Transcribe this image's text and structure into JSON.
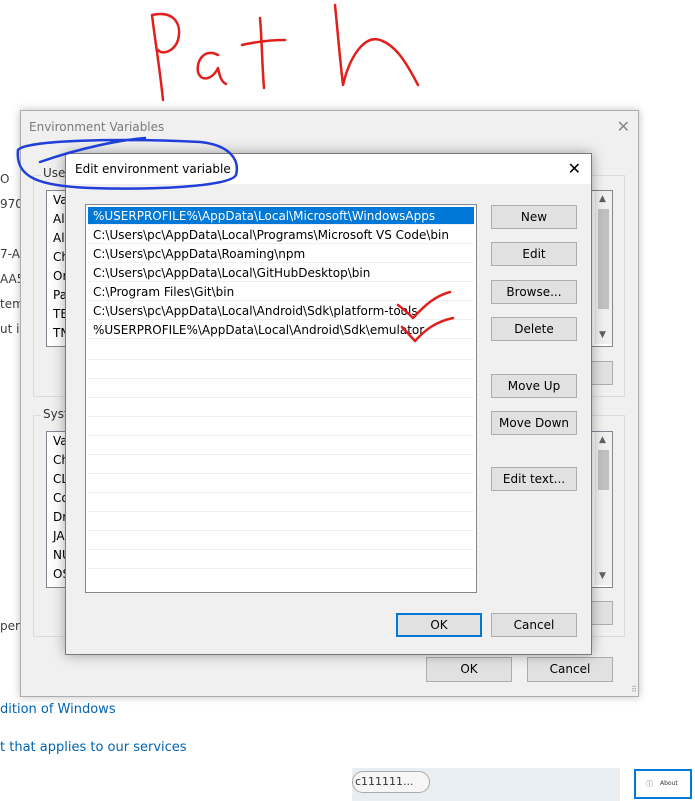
{
  "background_page": {
    "fragments": [
      "O",
      "970",
      "7-A",
      "AA5",
      "tem",
      "ut i",
      "per"
    ],
    "links": [
      "dition of Windows",
      "t that applies to our services"
    ],
    "bottom_pill_text": "c111111...",
    "thumbnail_label": "About"
  },
  "annotation": {
    "handwritten_text": "Path"
  },
  "env_dialog": {
    "title": "Environment Variables",
    "user_group_label": "User",
    "user_list_header": "Va",
    "user_list_items": [
      "Al",
      "Al",
      "Ch",
      "Or",
      "Pa",
      "TE",
      "TN"
    ],
    "system_group_label": "Syste",
    "system_list_header": "Va",
    "system_list_items": [
      "Ch",
      "CL",
      "Co",
      "Dr",
      "JA",
      "NU",
      "OS"
    ],
    "ok_label": "OK",
    "cancel_label": "Cancel"
  },
  "edit_dialog": {
    "title": "Edit environment variable",
    "paths": [
      "%USERPROFILE%\\AppData\\Local\\Microsoft\\WindowsApps",
      "C:\\Users\\pc\\AppData\\Local\\Programs\\Microsoft VS Code\\bin",
      "C:\\Users\\pc\\AppData\\Roaming\\npm",
      "C:\\Users\\pc\\AppData\\Local\\GitHubDesktop\\bin",
      "C:\\Program Files\\Git\\bin",
      "C:\\Users\\pc\\AppData\\Local\\Android\\Sdk\\platform-tools",
      "%USERPROFILE%\\AppData\\Local\\Android\\Sdk\\emulator"
    ],
    "selected_index": 0,
    "buttons": {
      "new": "New",
      "edit": "Edit",
      "browse": "Browse...",
      "delete": "Delete",
      "move_up": "Move Up",
      "move_down": "Move Down",
      "edit_text": "Edit text..."
    },
    "ok_label": "OK",
    "cancel_label": "Cancel"
  },
  "colors": {
    "selection": "#0078d7",
    "annotation_red": "#e0201c",
    "annotation_blue": "#1f3fd8",
    "link": "#0063b1"
  }
}
